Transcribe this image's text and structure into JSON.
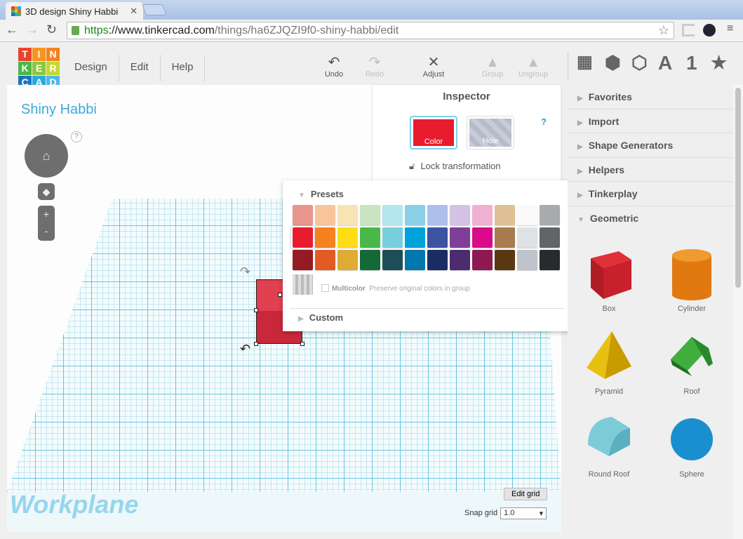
{
  "browser": {
    "tab_title": "3D design Shiny Habbi",
    "url_scheme": "https",
    "url_host": "://www.tinkercad.com",
    "url_path": "/things/ha6ZJQZI9f0-shiny-habbi/edit"
  },
  "logo": [
    "T",
    "I",
    "N",
    "K",
    "E",
    "R",
    "C",
    "A",
    "D"
  ],
  "menu": [
    "Design",
    "Edit",
    "Help"
  ],
  "tools": {
    "undo": "Undo",
    "redo": "Redo",
    "adjust": "Adjust",
    "group": "Group",
    "ungroup": "Ungroup"
  },
  "right_tools": {
    "text": "A",
    "number": "1"
  },
  "design": {
    "title": "Shiny Habbi",
    "workplane": "Workplane",
    "help": "?",
    "zoom_in": "+",
    "zoom_out": "-"
  },
  "grid": {
    "edit_grid": "Edit grid",
    "snap_label": "Snap grid",
    "snap_value": "1.0"
  },
  "inspector": {
    "title": "Inspector",
    "color": "Color",
    "hole": "Hole",
    "help": "?",
    "lock": "Lock transformation",
    "selected_color": "#e81c2e"
  },
  "colors": {
    "presets": "Presets",
    "multicolor": "Multicolor",
    "multicolor_desc": "Preserve original colors in group",
    "custom": "Custom",
    "palette": [
      "#e8968c",
      "#f9c49a",
      "#f7e4b5",
      "#c8e4c0",
      "#b3e6ee",
      "#89cfe8",
      "#adbfeb",
      "#d4c2e6",
      "#efb1d2",
      "#e0c096",
      "#fafafa",
      "#a7abae",
      "#e81c2e",
      "#f5821f",
      "#fedd16",
      "#4ab848",
      "#77cfdd",
      "#00a2d9",
      "#3c53a1",
      "#7f3e98",
      "#d90b8a",
      "#a97b51",
      "#dfe2e4",
      "#626568",
      "#961a22",
      "#e15b24",
      "#e0ab35",
      "#136a37",
      "#1c4e58",
      "#0078ab",
      "#1a2d63",
      "#4b2c6f",
      "#8f1952",
      "#5a3811",
      "#bec4ca",
      "#282b2d"
    ]
  },
  "sidebar": {
    "categories": [
      "Favorites",
      "Import",
      "Shape Generators",
      "Helpers",
      "Tinkerplay",
      "Geometric"
    ],
    "shapes": [
      "Box",
      "Cylinder",
      "Pyramid",
      "Roof",
      "Round Roof",
      "Sphere"
    ]
  }
}
